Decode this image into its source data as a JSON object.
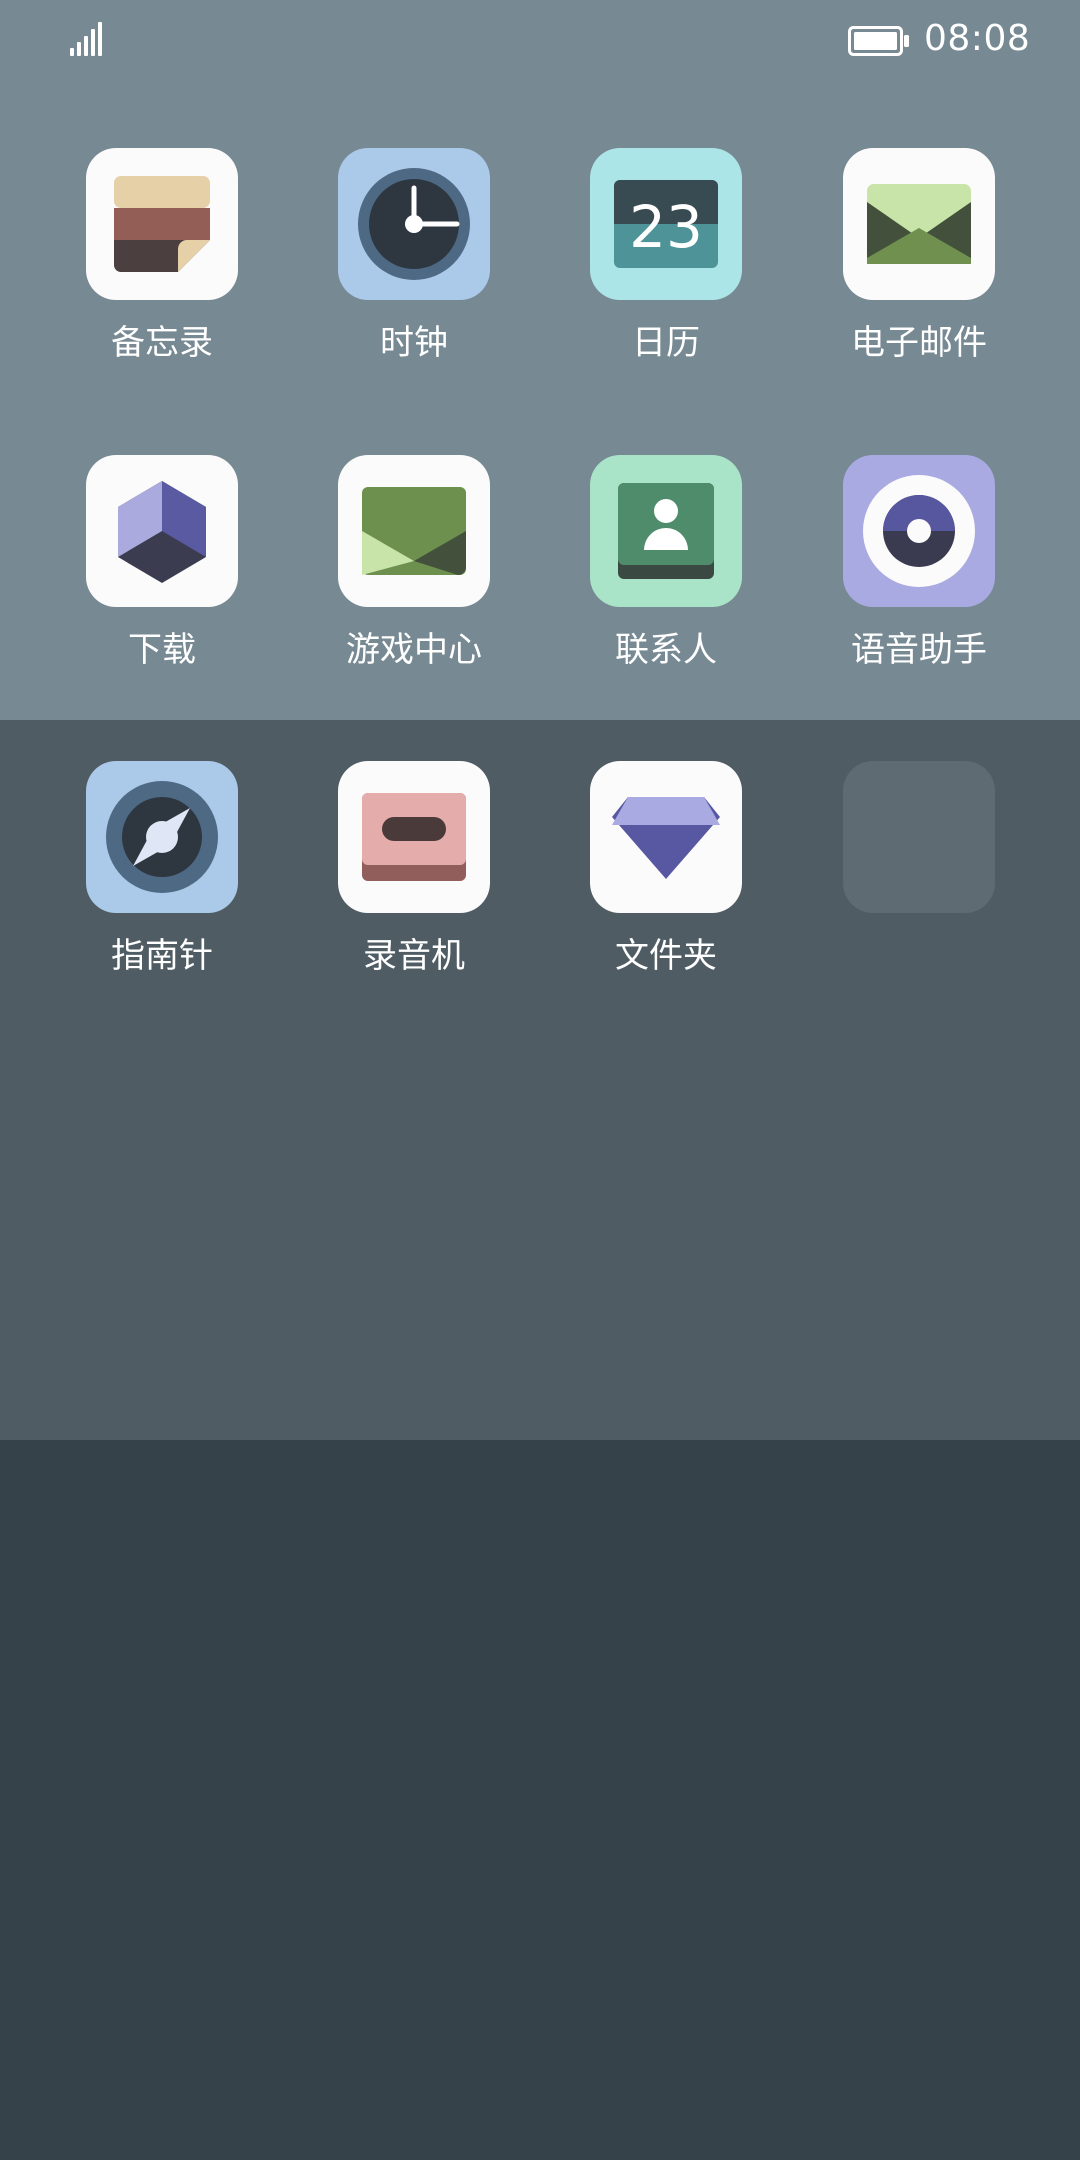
{
  "status_bar": {
    "time": "08:08",
    "signal_icon": "signal-bars-icon",
    "battery_icon": "battery-full-icon"
  },
  "apps": [
    {
      "label": "备忘录",
      "icon": "memo-icon"
    },
    {
      "label": "时钟",
      "icon": "clock-icon"
    },
    {
      "label": "日历",
      "icon": "calendar-icon",
      "icon_text": "23"
    },
    {
      "label": "电子邮件",
      "icon": "email-icon"
    },
    {
      "label": "下载",
      "icon": "download-icon"
    },
    {
      "label": "游戏中心",
      "icon": "game-center-icon"
    },
    {
      "label": "联系人",
      "icon": "contacts-icon"
    },
    {
      "label": "语音助手",
      "icon": "voice-assistant-icon"
    },
    {
      "label": "指南针",
      "icon": "compass-icon"
    },
    {
      "label": "录音机",
      "icon": "recorder-icon"
    },
    {
      "label": "文件夹",
      "icon": "folder-icon"
    }
  ],
  "colors": {
    "wallpaper_top": "#778993",
    "wallpaper_middle": "#4f5c63",
    "wallpaper_bottom": "#35424a",
    "label_text": "#ffffff"
  }
}
